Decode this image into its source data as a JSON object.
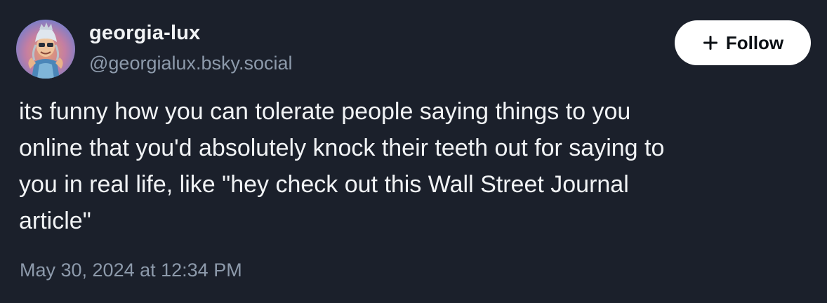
{
  "author": {
    "display_name": "georgia-lux",
    "handle": "@georgialux.bsky.social",
    "avatar_icon": "illustrated-character-avatar"
  },
  "follow_button": {
    "label": "Follow",
    "icon": "plus-icon"
  },
  "post": {
    "text_lines": [
      "its funny how you can tolerate people saying things to you",
      "online that you'd absolutely knock their teeth out for saying to",
      "you in real life, like \"hey check out this Wall Street Journal",
      "article\""
    ],
    "timestamp": "May 30, 2024 at 12:34 PM"
  },
  "colors": {
    "background": "#1b202b",
    "primary_text": "#f1f3f5",
    "secondary_text": "#8d9aab",
    "button_bg": "#ffffff",
    "button_text": "#0b0f14"
  }
}
